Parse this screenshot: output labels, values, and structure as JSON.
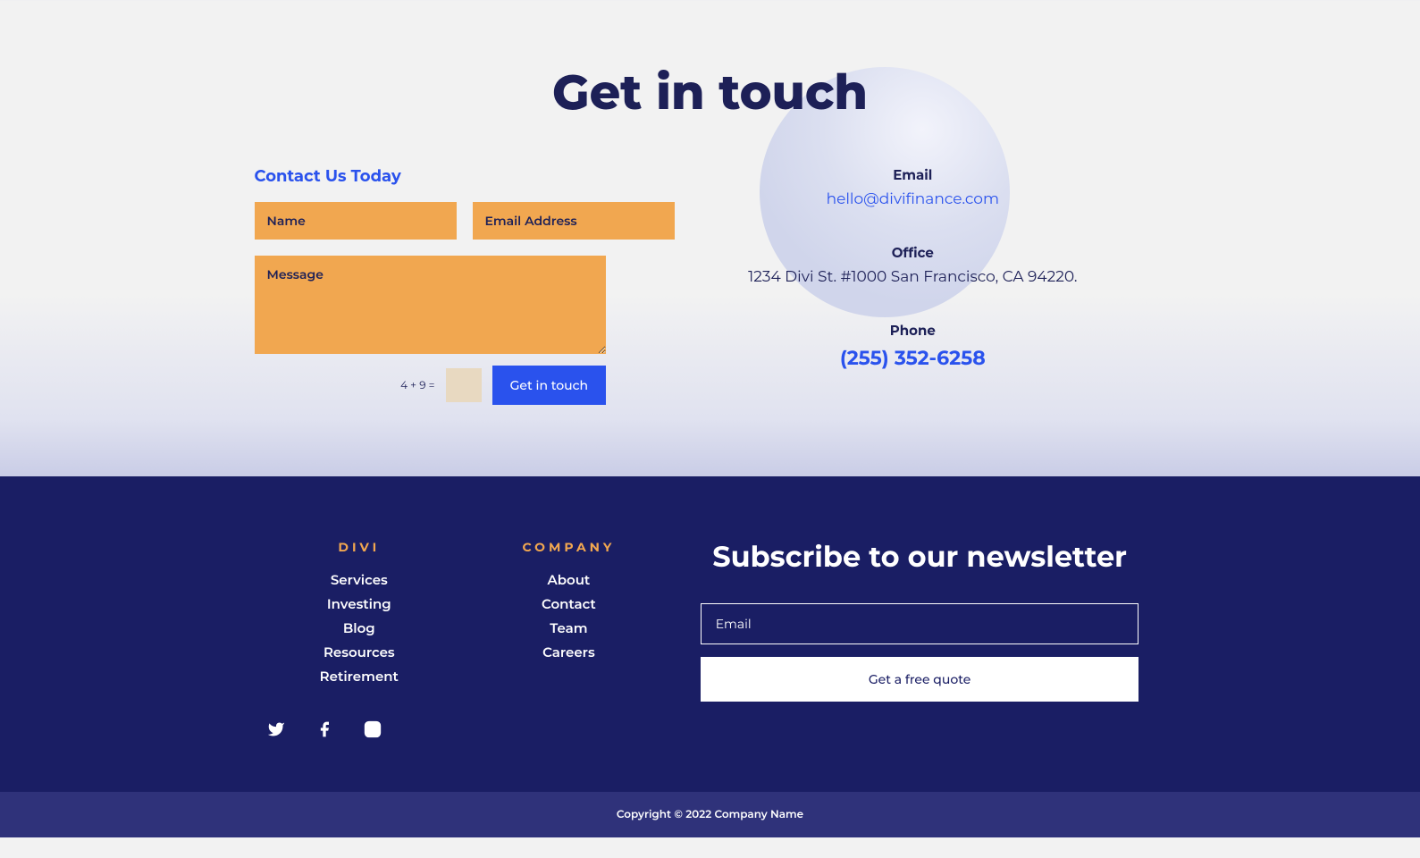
{
  "main_title": "Get in touch",
  "contact": {
    "heading": "Contact Us Today",
    "name_placeholder": "Name",
    "email_placeholder": "Email Address",
    "message_placeholder": "Message",
    "captcha_question": "4 + 9 =",
    "submit_label": "Get in touch"
  },
  "info": {
    "email_label": "Email",
    "email_value": "hello@divifinance.com",
    "office_label": "Office",
    "office_value": "1234 Divi St. #1000 San Francisco, CA 94220.",
    "phone_label": "Phone",
    "phone_value": "(255) 352-6258"
  },
  "footer": {
    "col1_label": "DIVI",
    "col1_links": [
      "Services",
      "Investing",
      "Blog",
      "Resources",
      "Retirement"
    ],
    "col2_label": "COMPANY",
    "col2_links": [
      "About",
      "Contact",
      "Team",
      "Careers"
    ],
    "newsletter_title": "Subscribe to our newsletter",
    "email_placeholder": "Email",
    "quote_label": "Get a free quote"
  },
  "copyright": "Copyright © 2022 Company Name"
}
